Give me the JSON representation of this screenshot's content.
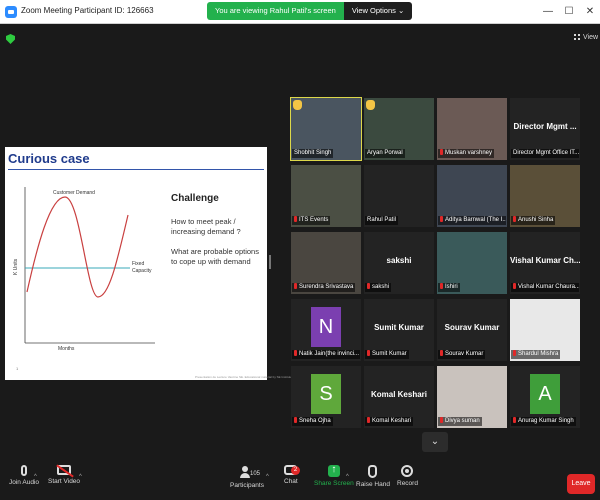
{
  "window": {
    "title": "Zoom Meeting Participant ID: 126663",
    "minimize": "—",
    "maximize": "☐",
    "close": "✕"
  },
  "share_banner": {
    "viewing_text": "You are viewing Rahul Patil's screen",
    "view_options_label": "View Options ⌄"
  },
  "view_button": {
    "label": "View"
  },
  "slide": {
    "heading": "Curious case",
    "curve_label": "Customer Demand",
    "capacity_label_1": "Fixed",
    "capacity_label_2": "Capacity",
    "y_axis_label": "K Units",
    "x_axis_label": "Months",
    "challenge_title": "Challenge",
    "question_1": "How to meet peak / increasing demand ?",
    "question_2": "What are probable options to cope up with demand",
    "page_number": "1",
    "footnote": "Presentation de Lecture Vaccine SE. Educational material by SE Institute 2020",
    "colors": {
      "demand_curve": "#c94040",
      "capacity_line": "#3aa8b8",
      "heading": "#1f3b8c"
    }
  },
  "participants": [
    {
      "label": "Shobhit Singh",
      "active": true,
      "hand_raised": true,
      "muted": false
    },
    {
      "label": "Aryan Porwal",
      "hand_raised": true,
      "muted": false
    },
    {
      "label": "Muskan varshney",
      "muted": true
    },
    {
      "big_name": "Director  Mgmt ...",
      "label": "Director Mgmt Office IT...",
      "muted": false
    },
    {
      "label": "ITS Events",
      "muted": true
    },
    {
      "label": "Rahul Patil",
      "muted": false
    },
    {
      "label": "Aditya Barnwal (The I...",
      "muted": true
    },
    {
      "label": "Anushi Sinha",
      "muted": true
    },
    {
      "label": "Surendra Srivastava",
      "muted": true
    },
    {
      "big_name": "sakshi",
      "label": "sakshi",
      "muted": true
    },
    {
      "label": "Ishiri",
      "muted": true
    },
    {
      "big_name": "Vishal Kumar Ch...",
      "label": "Vishal Kumar Chaura...",
      "muted": true
    },
    {
      "avatar_letter": "N",
      "avatar_color": "#7b3fb0",
      "label": "Natik Jain(the invinci...",
      "muted": true
    },
    {
      "big_name": "Sumit Kumar",
      "label": "Sumit Kumar",
      "muted": true
    },
    {
      "big_name": "Sourav Kumar",
      "label": "Sourav Kumar",
      "muted": true
    },
    {
      "label": "Shardul Mishra",
      "muted": true
    },
    {
      "avatar_letter": "S",
      "avatar_color": "#5fa83b",
      "label": "Sneha Ojha",
      "muted": true
    },
    {
      "big_name": "Komal Keshari",
      "label": "Komal Keshari",
      "muted": true
    },
    {
      "label": "Divya suman",
      "muted": true
    },
    {
      "avatar_letter": "A",
      "avatar_color": "#3f9e3a",
      "label": "Anurag Kumar Singh",
      "muted": true
    }
  ],
  "toolbar": {
    "join_audio": "Join Audio",
    "start_video": "Start Video",
    "participants": "Participants",
    "participants_count": "105",
    "chat": "Chat",
    "chat_badge": "2",
    "share_screen": "Share Screen",
    "raise_hand": "Raise Hand",
    "record": "Record",
    "leave": "Leave",
    "caret": "^"
  },
  "scroll_down": "⌄"
}
